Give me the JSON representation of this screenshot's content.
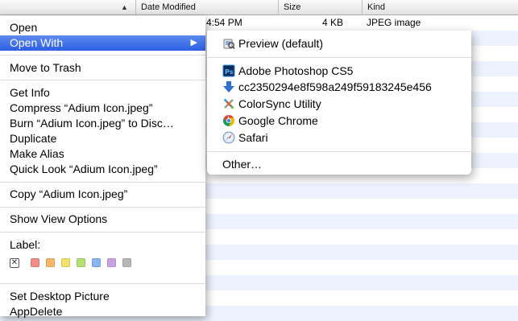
{
  "header": {
    "date_modified": "Date Modified",
    "size": "Size",
    "kind": "Kind"
  },
  "selected_row": {
    "date": "4:54 PM",
    "size": "4 KB",
    "kind": "JPEG image"
  },
  "menu": {
    "open": "Open",
    "open_with": "Open With",
    "move_to_trash": "Move to Trash",
    "get_info": "Get Info",
    "compress": "Compress “Adium Icon.jpeg”",
    "burn": "Burn “Adium Icon.jpeg” to Disc…",
    "duplicate": "Duplicate",
    "make_alias": "Make Alias",
    "quick_look": "Quick Look “Adium Icon.jpeg”",
    "copy": "Copy “Adium Icon.jpeg”",
    "show_view_options": "Show View Options",
    "label": "Label:",
    "label_colors": [
      "#f28d85",
      "#f7b765",
      "#f0e26a",
      "#b4df73",
      "#86b6f2",
      "#c9a2e2",
      "#b8b8b8"
    ],
    "set_desktop_picture": "Set Desktop Picture",
    "app_delete": "AppDelete"
  },
  "submenu": {
    "preview": "Preview (default)",
    "photoshop": "Adobe Photoshop CS5",
    "hash_app": "cc2350294e8f598a249f59183245e456",
    "colorsync": "ColorSync Utility",
    "chrome": "Google Chrome",
    "safari": "Safari",
    "other": "Other…"
  },
  "colors": {
    "highlight": "#3b6fe8",
    "row_alt": "#edf3fe"
  }
}
